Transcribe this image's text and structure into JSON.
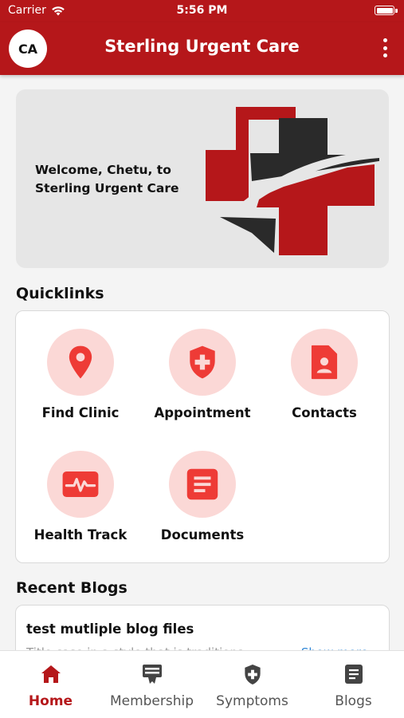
{
  "status_bar": {
    "carrier": "Carrier",
    "time": "5:56 PM"
  },
  "header": {
    "avatar_initials": "CA",
    "title": "Sterling Urgent Care",
    "menu_icon": "more-vertical-icon"
  },
  "welcome": {
    "message": "Welcome, Chetu, to Sterling Urgent Care",
    "logo": "sterling-cross-logo"
  },
  "quicklinks": {
    "title": "Quicklinks",
    "items": [
      {
        "label": "Find Clinic",
        "icon": "map-pin-icon"
      },
      {
        "label": "Appointment",
        "icon": "shield-plus-icon"
      },
      {
        "label": "Contacts",
        "icon": "contact-file-icon"
      },
      {
        "label": "Health Track",
        "icon": "heartbeat-icon"
      },
      {
        "label": "Documents",
        "icon": "document-icon"
      }
    ]
  },
  "blogs": {
    "title": "Recent Blogs",
    "items": [
      {
        "title": "test mutliple blog files",
        "excerpt": "Title case in a style that is traditiona",
        "more_label": "Show more"
      }
    ]
  },
  "tabbar": {
    "active": "Home",
    "items": [
      {
        "label": "Home",
        "icon": "home-icon"
      },
      {
        "label": "Membership",
        "icon": "membership-card-icon"
      },
      {
        "label": "Symptoms",
        "icon": "shield-plus-icon"
      },
      {
        "label": "Blogs",
        "icon": "blog-document-icon"
      }
    ]
  },
  "colors": {
    "brand_red": "#b5171a",
    "icon_red": "#ee3b36",
    "icon_bg": "#fbd8d6",
    "link_blue": "#2f86d6"
  }
}
